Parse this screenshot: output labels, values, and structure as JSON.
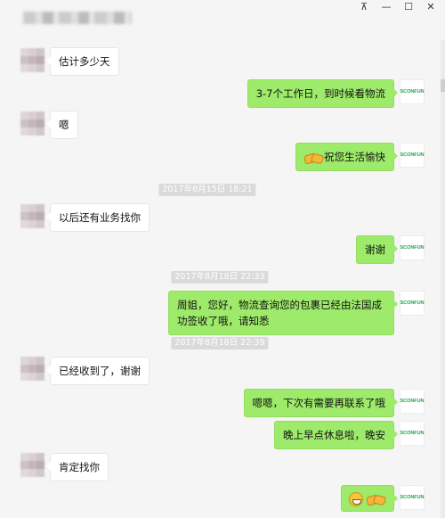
{
  "window": {
    "pin_icon": "pin-icon",
    "controls": [
      "minimize-icon",
      "maximize-icon",
      "close-icon"
    ]
  },
  "avatars": {
    "self_label": "SCONFUN"
  },
  "messages": [
    {
      "side": "in",
      "text": "估计多少天"
    },
    {
      "side": "out",
      "text": "3-7个工作日，到时候看物流"
    },
    {
      "side": "in",
      "text": "嗯"
    },
    {
      "side": "out",
      "text": "祝您生活愉快",
      "emoji": "handshake"
    },
    {
      "timestamp": "2017年8月15日 18:21"
    },
    {
      "side": "in",
      "text": "以后还有业务找你"
    },
    {
      "side": "out",
      "text": "谢谢"
    },
    {
      "timestamp": "2017年8月18日 22:33"
    },
    {
      "side": "out",
      "text": "周姐，您好，物流查询您的包裹已经由法国成功签收了哦，请知悉"
    },
    {
      "timestamp": "2017年8月18日 22:39"
    },
    {
      "side": "in",
      "text": "已经收到了，谢谢"
    },
    {
      "side": "out",
      "text": "嗯嗯，下次有需要再联系了哦"
    },
    {
      "side": "out",
      "text": "晚上早点休息啦，晚安"
    },
    {
      "side": "in",
      "text": "肯定找你"
    },
    {
      "side": "out",
      "text": "",
      "emoji": "grin-handshake"
    }
  ],
  "colors": {
    "background": "#f5f5f5",
    "outgoing_bubble": "#9eea6a",
    "incoming_bubble": "#ffffff",
    "timestamp_bg": "#dadada",
    "brand_green": "#2aa24e"
  }
}
